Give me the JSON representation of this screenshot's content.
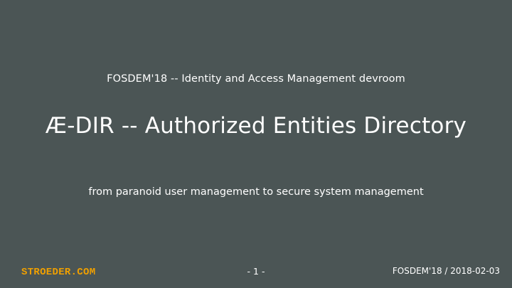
{
  "slide": {
    "event": "FOSDEM'18 -- Identity and Access Management devroom",
    "title": "Æ-DIR -- Authorized Entities Directory",
    "subtitle": "from paranoid user management to secure system management"
  },
  "footer": {
    "logo_text": "STROEDER.COM",
    "page_number": "- 1 -",
    "meta": "FOSDEM'18 / 2018-02-03"
  },
  "colors": {
    "background": "#4b5555",
    "text": "#ffffff",
    "logo": "#f0a000"
  }
}
